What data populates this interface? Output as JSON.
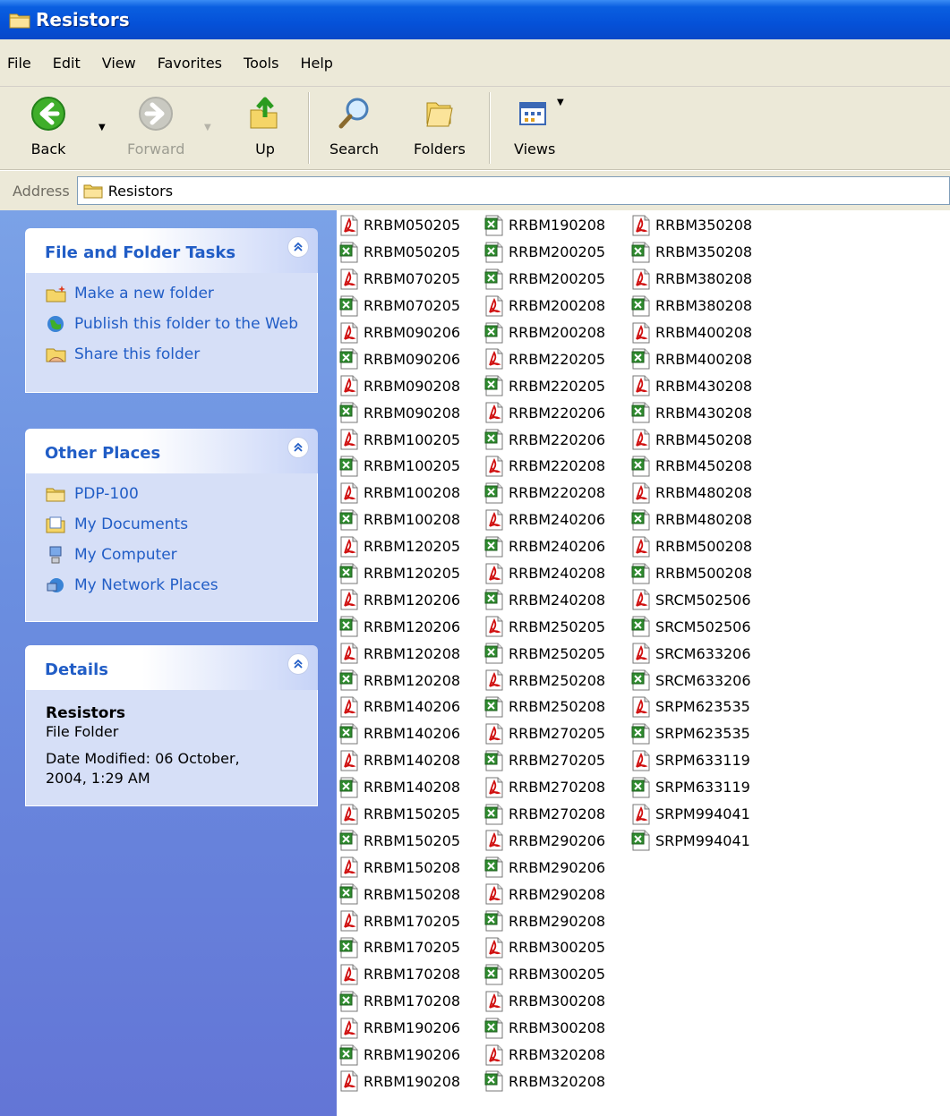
{
  "window": {
    "title": "Resistors"
  },
  "menu": [
    "File",
    "Edit",
    "View",
    "Favorites",
    "Tools",
    "Help"
  ],
  "toolbar": {
    "back": "Back",
    "forward": "Forward",
    "up": "Up",
    "search": "Search",
    "folders": "Folders",
    "views": "Views"
  },
  "address": {
    "label": "Address",
    "value": "Resistors"
  },
  "left_pane": {
    "file_folder_tasks": {
      "title": "File and Folder Tasks",
      "items": [
        {
          "label": "Make a new folder",
          "icon": "new-folder-icon"
        },
        {
          "label": "Publish this folder to the Web",
          "icon": "publish-web-icon"
        },
        {
          "label": "Share this folder",
          "icon": "share-folder-icon"
        }
      ]
    },
    "other_places": {
      "title": "Other Places",
      "items": [
        {
          "label": "PDP-100",
          "icon": "folder-icon"
        },
        {
          "label": "My Documents",
          "icon": "my-documents-icon"
        },
        {
          "label": "My Computer",
          "icon": "my-computer-icon"
        },
        {
          "label": "My Network Places",
          "icon": "network-places-icon"
        }
      ]
    },
    "details": {
      "title": "Details",
      "name": "Resistors",
      "type": "File Folder",
      "modified": "Date Modified: 06 October, 2004, 1:29 AM"
    }
  },
  "files": {
    "columns": [
      [
        {
          "name": "RRBM050205",
          "type": "pdf"
        },
        {
          "name": "RRBM050205",
          "type": "xls"
        },
        {
          "name": "RRBM070205",
          "type": "pdf"
        },
        {
          "name": "RRBM070205",
          "type": "xls"
        },
        {
          "name": "RRBM090206",
          "type": "pdf"
        },
        {
          "name": "RRBM090206",
          "type": "xls"
        },
        {
          "name": "RRBM090208",
          "type": "pdf"
        },
        {
          "name": "RRBM090208",
          "type": "xls"
        },
        {
          "name": "RRBM100205",
          "type": "pdf"
        },
        {
          "name": "RRBM100205",
          "type": "xls"
        },
        {
          "name": "RRBM100208",
          "type": "pdf"
        },
        {
          "name": "RRBM100208",
          "type": "xls"
        },
        {
          "name": "RRBM120205",
          "type": "pdf"
        },
        {
          "name": "RRBM120205",
          "type": "xls"
        },
        {
          "name": "RRBM120206",
          "type": "pdf"
        },
        {
          "name": "RRBM120206",
          "type": "xls"
        },
        {
          "name": "RRBM120208",
          "type": "pdf"
        },
        {
          "name": "RRBM120208",
          "type": "xls"
        },
        {
          "name": "RRBM140206",
          "type": "pdf"
        },
        {
          "name": "RRBM140206",
          "type": "xls"
        },
        {
          "name": "RRBM140208",
          "type": "pdf"
        },
        {
          "name": "RRBM140208",
          "type": "xls"
        },
        {
          "name": "RRBM150205",
          "type": "pdf"
        },
        {
          "name": "RRBM150205",
          "type": "xls"
        },
        {
          "name": "RRBM150208",
          "type": "pdf"
        },
        {
          "name": "RRBM150208",
          "type": "xls"
        },
        {
          "name": "RRBM170205",
          "type": "pdf"
        },
        {
          "name": "RRBM170205",
          "type": "xls"
        },
        {
          "name": "RRBM170208",
          "type": "pdf"
        },
        {
          "name": "RRBM170208",
          "type": "xls"
        },
        {
          "name": "RRBM190206",
          "type": "pdf"
        },
        {
          "name": "RRBM190206",
          "type": "xls"
        },
        {
          "name": "RRBM190208",
          "type": "pdf"
        }
      ],
      [
        {
          "name": "RRBM190208",
          "type": "xls"
        },
        {
          "name": "RRBM200205",
          "type": "xls"
        },
        {
          "name": "RRBM200205",
          "type": "xls"
        },
        {
          "name": "RRBM200208",
          "type": "pdf"
        },
        {
          "name": "RRBM200208",
          "type": "xls"
        },
        {
          "name": "RRBM220205",
          "type": "pdf"
        },
        {
          "name": "RRBM220205",
          "type": "xls"
        },
        {
          "name": "RRBM220206",
          "type": "pdf"
        },
        {
          "name": "RRBM220206",
          "type": "xls"
        },
        {
          "name": "RRBM220208",
          "type": "pdf"
        },
        {
          "name": "RRBM220208",
          "type": "xls"
        },
        {
          "name": "RRBM240206",
          "type": "pdf"
        },
        {
          "name": "RRBM240206",
          "type": "xls"
        },
        {
          "name": "RRBM240208",
          "type": "pdf"
        },
        {
          "name": "RRBM240208",
          "type": "xls"
        },
        {
          "name": "RRBM250205",
          "type": "pdf"
        },
        {
          "name": "RRBM250205",
          "type": "xls"
        },
        {
          "name": "RRBM250208",
          "type": "pdf"
        },
        {
          "name": "RRBM250208",
          "type": "xls"
        },
        {
          "name": "RRBM270205",
          "type": "pdf"
        },
        {
          "name": "RRBM270205",
          "type": "xls"
        },
        {
          "name": "RRBM270208",
          "type": "pdf"
        },
        {
          "name": "RRBM270208",
          "type": "xls"
        },
        {
          "name": "RRBM290206",
          "type": "pdf"
        },
        {
          "name": "RRBM290206",
          "type": "xls"
        },
        {
          "name": "RRBM290208",
          "type": "pdf"
        },
        {
          "name": "RRBM290208",
          "type": "xls"
        },
        {
          "name": "RRBM300205",
          "type": "pdf"
        },
        {
          "name": "RRBM300205",
          "type": "xls"
        },
        {
          "name": "RRBM300208",
          "type": "pdf"
        },
        {
          "name": "RRBM300208",
          "type": "xls"
        },
        {
          "name": "RRBM320208",
          "type": "pdf"
        },
        {
          "name": "RRBM320208",
          "type": "xls"
        }
      ],
      [
        {
          "name": "RRBM350208",
          "type": "pdf"
        },
        {
          "name": "RRBM350208",
          "type": "xls"
        },
        {
          "name": "RRBM380208",
          "type": "pdf"
        },
        {
          "name": "RRBM380208",
          "type": "xls"
        },
        {
          "name": "RRBM400208",
          "type": "pdf"
        },
        {
          "name": "RRBM400208",
          "type": "xls"
        },
        {
          "name": "RRBM430208",
          "type": "pdf"
        },
        {
          "name": "RRBM430208",
          "type": "xls"
        },
        {
          "name": "RRBM450208",
          "type": "pdf"
        },
        {
          "name": "RRBM450208",
          "type": "xls"
        },
        {
          "name": "RRBM480208",
          "type": "pdf"
        },
        {
          "name": "RRBM480208",
          "type": "xls"
        },
        {
          "name": "RRBM500208",
          "type": "pdf"
        },
        {
          "name": "RRBM500208",
          "type": "xls"
        },
        {
          "name": "SRCM502506",
          "type": "pdf"
        },
        {
          "name": "SRCM502506",
          "type": "xls"
        },
        {
          "name": "SRCM633206",
          "type": "pdf"
        },
        {
          "name": "SRCM633206",
          "type": "xls"
        },
        {
          "name": "SRPM623535",
          "type": "pdf"
        },
        {
          "name": "SRPM623535",
          "type": "xls"
        },
        {
          "name": "SRPM633119",
          "type": "pdf"
        },
        {
          "name": "SRPM633119",
          "type": "xls"
        },
        {
          "name": "SRPM994041",
          "type": "pdf"
        },
        {
          "name": "SRPM994041",
          "type": "xls"
        }
      ]
    ]
  },
  "colors": {
    "title_bar": "#0551d8",
    "link_blue": "#215dc6",
    "pane_bg": "#6b8fe0",
    "chrome": "#ece9d8"
  }
}
